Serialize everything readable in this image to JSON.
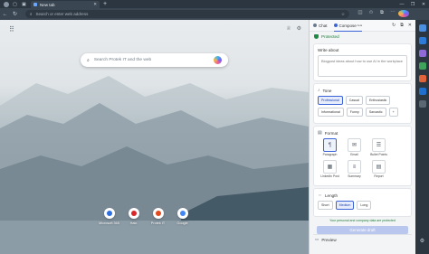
{
  "browser": {
    "tab_title": "New tab",
    "tab_close": "✕",
    "new_tab": "+",
    "address_placeholder": "Search or enter web address",
    "window_controls": [
      "—",
      "❐",
      "✕"
    ]
  },
  "newtab": {
    "search_placeholder": "Search Protek IT and the web",
    "shortcuts": [
      {
        "label": "Microsoft 365",
        "color": "#2c6de0"
      },
      {
        "label": "Halo",
        "color": "#d9262b"
      },
      {
        "label": "Protek IT",
        "color": "#e24a1e"
      },
      {
        "label": "Google",
        "color": "#4285f4"
      }
    ]
  },
  "panel": {
    "tabs": {
      "chat": "Chat",
      "compose": "Compose",
      "compose_sub": "beta"
    },
    "protected": "Protected",
    "write_about": {
      "title": "Write about",
      "placeholder": "Blogpost ideas about how to use AI in the workplace"
    },
    "tone": {
      "title": "Tone",
      "options": [
        "Professional",
        "Casual",
        "Enthusiastic",
        "Informational",
        "Funny",
        "Sarcastic"
      ],
      "selected": "Professional",
      "more": "+"
    },
    "format": {
      "title": "Format",
      "options": [
        {
          "label": "Paragraph",
          "icon": "¶"
        },
        {
          "label": "Email",
          "icon": "✉"
        },
        {
          "label": "Bullet Points",
          "icon": "☰"
        },
        {
          "label": "LinkedIn Post",
          "icon": "▦"
        },
        {
          "label": "Summary",
          "icon": "≡"
        },
        {
          "label": "Report",
          "icon": "▤"
        }
      ],
      "selected": "Paragraph"
    },
    "length": {
      "title": "Length",
      "options": [
        "Short",
        "Medium",
        "Long"
      ],
      "selected": "Medium"
    },
    "note": "Your personal and company data are protected",
    "generate": "Generate draft",
    "preview": "Preview"
  },
  "colors": {
    "accent": "#3b63d8",
    "protected_green": "#1f7a39"
  }
}
